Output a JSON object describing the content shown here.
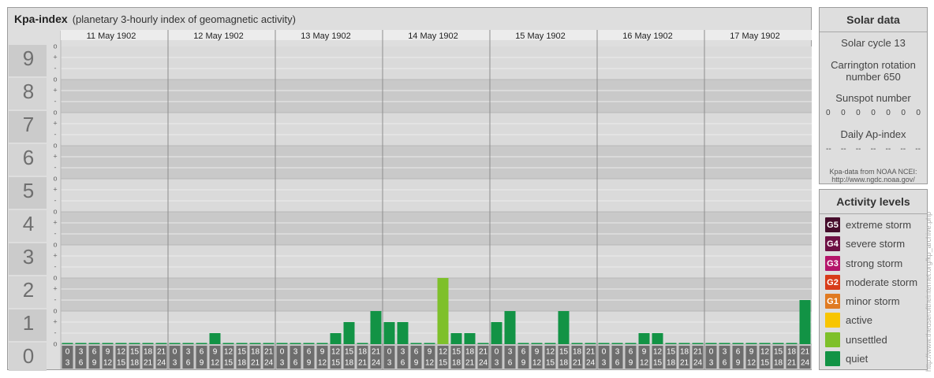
{
  "title": "Kpa-index",
  "subtitle": "(planetary 3-hourly index of geomagnetic activity)",
  "chart_data": {
    "type": "bar",
    "title": "Kpa-index",
    "subtitle": "(planetary 3-hourly index of geomagnetic activity)",
    "ylim": [
      0,
      9
    ],
    "y_ticks": [
      "0",
      "1",
      "2",
      "3",
      "4",
      "5",
      "6",
      "7",
      "8",
      "9"
    ],
    "sub_ticks": [
      "o",
      "-",
      "+"
    ],
    "days": [
      "11 May 1902",
      "12 May 1902",
      "13 May 1902",
      "14 May 1902",
      "15 May 1902",
      "16 May 1902",
      "17 May 1902"
    ],
    "interval_top": [
      "0",
      "3",
      "6",
      "9",
      "12",
      "15",
      "18",
      "21"
    ],
    "interval_bottom": [
      "3",
      "6",
      "9",
      "12",
      "15",
      "18",
      "21",
      "24"
    ],
    "values": [
      0,
      0,
      0,
      0,
      0,
      0,
      0,
      0,
      0,
      0,
      0,
      0.333,
      0,
      0,
      0,
      0,
      0,
      0,
      0,
      0,
      0.333,
      0.667,
      0,
      1,
      0.667,
      0.667,
      0,
      0,
      2,
      0.333,
      0.333,
      0,
      0.667,
      1,
      0,
      0,
      0,
      1,
      0,
      0,
      0,
      0,
      0,
      0.333,
      0.333,
      0,
      0,
      0,
      0,
      0,
      0,
      0,
      0,
      0,
      0,
      1.333
    ],
    "grid": true,
    "colors": {
      "quiet": "#129345",
      "unsettled": "#7ec02a",
      "active": "#f8c500",
      "g1": "#e07b22",
      "g2": "#d83c1a",
      "g3": "#b5156a",
      "g4": "#6e1044",
      "g5": "#460d2c"
    }
  },
  "solar": {
    "header": "Solar data",
    "cycle": "Solar cycle 13",
    "carrington": "Carrington rotation number 650",
    "sunspot_label": "Sunspot number",
    "sunspot_values": [
      "0",
      "0",
      "0",
      "0",
      "0",
      "0",
      "0"
    ],
    "ap_label": "Daily Ap-index",
    "ap_values": [
      "--",
      "--",
      "--",
      "--",
      "--",
      "--",
      "--"
    ],
    "source": "Kpa-data from NOAA NCEI:",
    "source_url": "http://www.ngdc.noaa.gov/"
  },
  "activity": {
    "header": "Activity levels",
    "levels": [
      {
        "badge": "G5",
        "label": "extreme storm",
        "color": "#460d2c"
      },
      {
        "badge": "G4",
        "label": "severe storm",
        "color": "#6e1044"
      },
      {
        "badge": "G3",
        "label": "strong storm",
        "color": "#b5156a"
      },
      {
        "badge": "G2",
        "label": "moderate storm",
        "color": "#d83c1a"
      },
      {
        "badge": "G1",
        "label": "minor storm",
        "color": "#e07b22"
      },
      {
        "badge": "",
        "label": "active",
        "color": "#f8c500"
      },
      {
        "badge": "",
        "label": "unsettled",
        "color": "#7ec02a"
      },
      {
        "badge": "",
        "label": "quiet",
        "color": "#129345"
      }
    ]
  },
  "watermark": "http://www.theuseroftheinternet.org/kp_archive.php"
}
